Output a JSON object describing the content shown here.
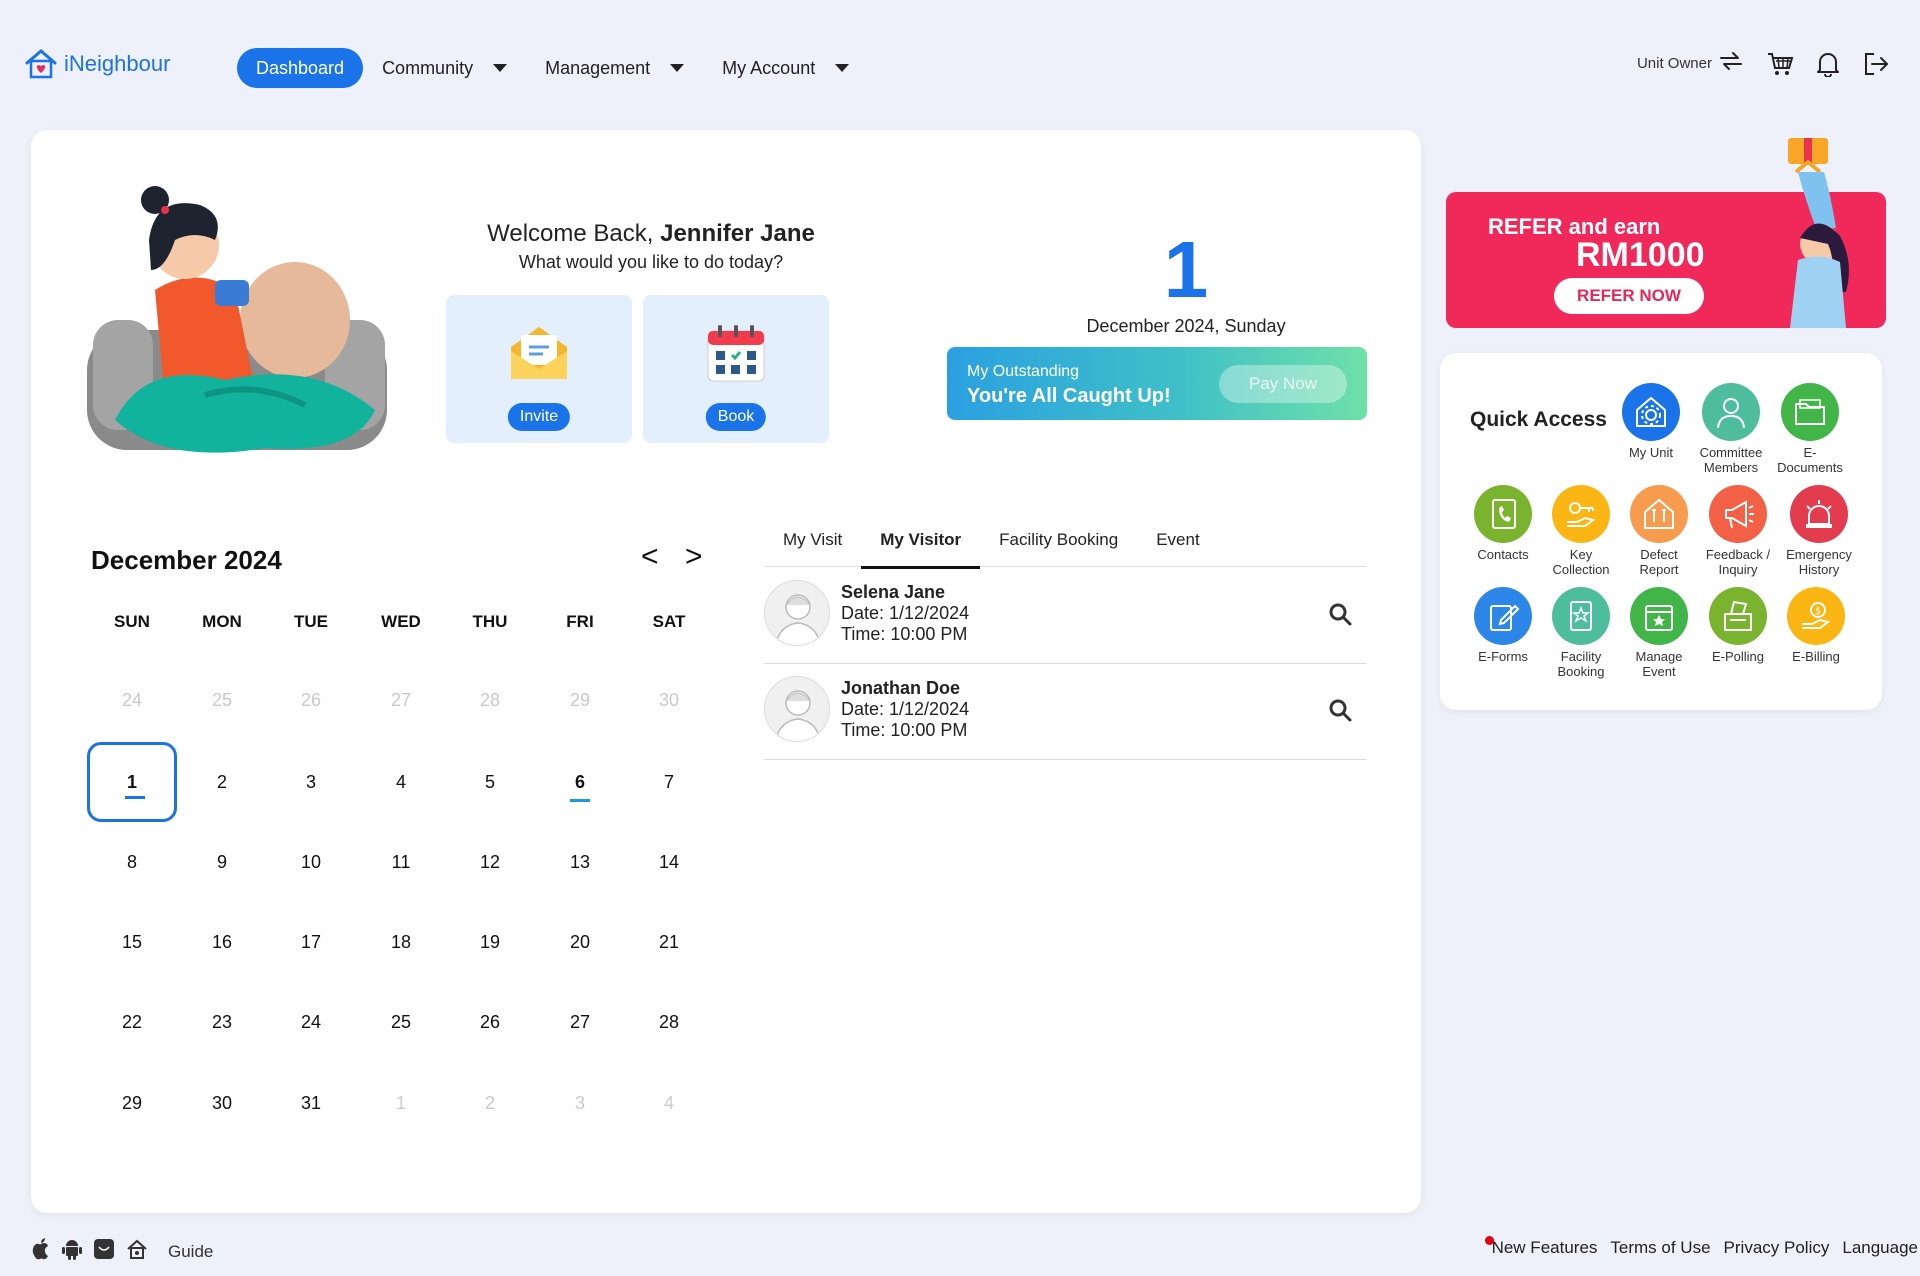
{
  "app": {
    "name": "iNeighbour",
    "brand_color": "#1a73e8"
  },
  "nav": {
    "dashboard": "Dashboard",
    "community": "Community",
    "management": "Management",
    "my_account": "My Account"
  },
  "header": {
    "role": "Unit Owner"
  },
  "welcome": {
    "greeting": "Welcome Back,",
    "user_name": "Jennifer Jane",
    "prompt": "What would you like to do today?",
    "invite_label": "Invite",
    "book_label": "Book"
  },
  "today": {
    "day": "1",
    "date_text": "December 2024, Sunday"
  },
  "outstanding": {
    "label": "My Outstanding",
    "status": "You're All Caught Up!",
    "pay_button": "Pay Now"
  },
  "calendar": {
    "month_label": "December 2024",
    "prev": "<",
    "next": ">",
    "weekdays": [
      "SUN",
      "MON",
      "TUE",
      "WED",
      "THU",
      "FRI",
      "SAT"
    ],
    "weeks": [
      [
        "24",
        "25",
        "26",
        "27",
        "28",
        "29",
        "30"
      ],
      [
        "1",
        "2",
        "3",
        "4",
        "5",
        "6",
        "7"
      ],
      [
        "8",
        "9",
        "10",
        "11",
        "12",
        "13",
        "14"
      ],
      [
        "15",
        "16",
        "17",
        "18",
        "19",
        "20",
        "21"
      ],
      [
        "22",
        "23",
        "24",
        "25",
        "26",
        "27",
        "28"
      ],
      [
        "29",
        "30",
        "31",
        "1",
        "2",
        "3",
        "4"
      ]
    ]
  },
  "tabs": [
    "My Visit",
    "My Visitor",
    "Facility Booking",
    "Event"
  ],
  "active_tab": "My Visitor",
  "visitors": [
    {
      "name": "Selena Jane",
      "date": "Date: 1/12/2024",
      "time": "Time: 10:00 PM"
    },
    {
      "name": "Jonathan Doe",
      "date": "Date: 1/12/2024",
      "time": "Time: 10:00 PM"
    }
  ],
  "promo": {
    "line1": "REFER and earn",
    "line2": "RM1000",
    "button": "REFER NOW",
    "color": "#f0295a"
  },
  "quick_access": {
    "title": "Quick Access",
    "items": [
      {
        "label": "My Unit",
        "icon": "home-gear-icon",
        "color": "#1a73e8"
      },
      {
        "label": "Committee Members",
        "icon": "person-icon",
        "color": "#4dbd9b"
      },
      {
        "label": "E-Documents",
        "icon": "folder-icon",
        "color": "#42b549"
      },
      {
        "label": "Contacts",
        "icon": "phone-book-icon",
        "color": "#7ab32e"
      },
      {
        "label": "Key Collection",
        "icon": "key-hand-icon",
        "color": "#fbb614"
      },
      {
        "label": "Defect Report",
        "icon": "house-tools-icon",
        "color": "#f79b4e"
      },
      {
        "label": "Feedback / Inquiry",
        "icon": "megaphone-icon",
        "color": "#f26046"
      },
      {
        "label": "Emergency History",
        "icon": "siren-icon",
        "color": "#e23c4e"
      },
      {
        "label": "E-Forms",
        "icon": "form-edit-icon",
        "color": "#2d87e8"
      },
      {
        "label": "Facility Booking",
        "icon": "badge-icon",
        "color": "#4dbd9b"
      },
      {
        "label": "Manage Event",
        "icon": "calendar-star-icon",
        "color": "#42b549"
      },
      {
        "label": "E-Polling",
        "icon": "ballot-box-icon",
        "color": "#7ab32e"
      },
      {
        "label": "E-Billing",
        "icon": "coin-hand-icon",
        "color": "#fbb614"
      }
    ]
  },
  "footer": {
    "guide": "Guide",
    "links": [
      "New Features",
      "Terms of Use",
      "Privacy Policy",
      "Language"
    ]
  }
}
